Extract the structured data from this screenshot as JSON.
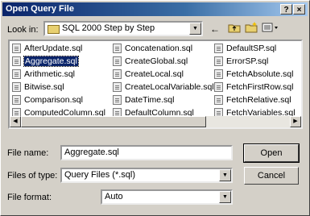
{
  "window": {
    "title": "Open Query File",
    "help_label": "?",
    "close_label": "×"
  },
  "lookin": {
    "label": "Look in:",
    "value": "SQL 2000 Step by Step"
  },
  "toolbar": {
    "back": "←",
    "up": "folder-up",
    "new": "new-folder",
    "view": "view-menu"
  },
  "files": [
    {
      "name": "AfterUpdate.sql",
      "selected": false
    },
    {
      "name": "Aggregate.sql",
      "selected": true
    },
    {
      "name": "Arithmetic.sql",
      "selected": false
    },
    {
      "name": "Bitwise.sql",
      "selected": false
    },
    {
      "name": "Comparison.sql",
      "selected": false
    },
    {
      "name": "ComputedColumn.sql",
      "selected": false
    },
    {
      "name": "Concatenation.sql",
      "selected": false
    },
    {
      "name": "CreateGlobal.sql",
      "selected": false
    },
    {
      "name": "CreateLocal.sql",
      "selected": false
    },
    {
      "name": "CreateLocalVariable.sql",
      "selected": false
    },
    {
      "name": "DateTime.sql",
      "selected": false
    },
    {
      "name": "DefaultColumn.sql",
      "selected": false
    },
    {
      "name": "DefaultSP.sql",
      "selected": false
    },
    {
      "name": "ErrorSP.sql",
      "selected": false
    },
    {
      "name": "FetchAbsolute.sql",
      "selected": false
    },
    {
      "name": "FetchFirstRow.sql",
      "selected": false
    },
    {
      "name": "FetchRelative.sql",
      "selected": false
    },
    {
      "name": "FetchVariables.sql",
      "selected": false
    }
  ],
  "filename": {
    "label": "File name:",
    "value": "Aggregate.sql"
  },
  "filetype": {
    "label": "Files of type:",
    "value": "Query Files (*.sql)"
  },
  "fileformat": {
    "label": "File format:",
    "value": "Auto"
  },
  "buttons": {
    "open": "Open",
    "cancel": "Cancel"
  }
}
